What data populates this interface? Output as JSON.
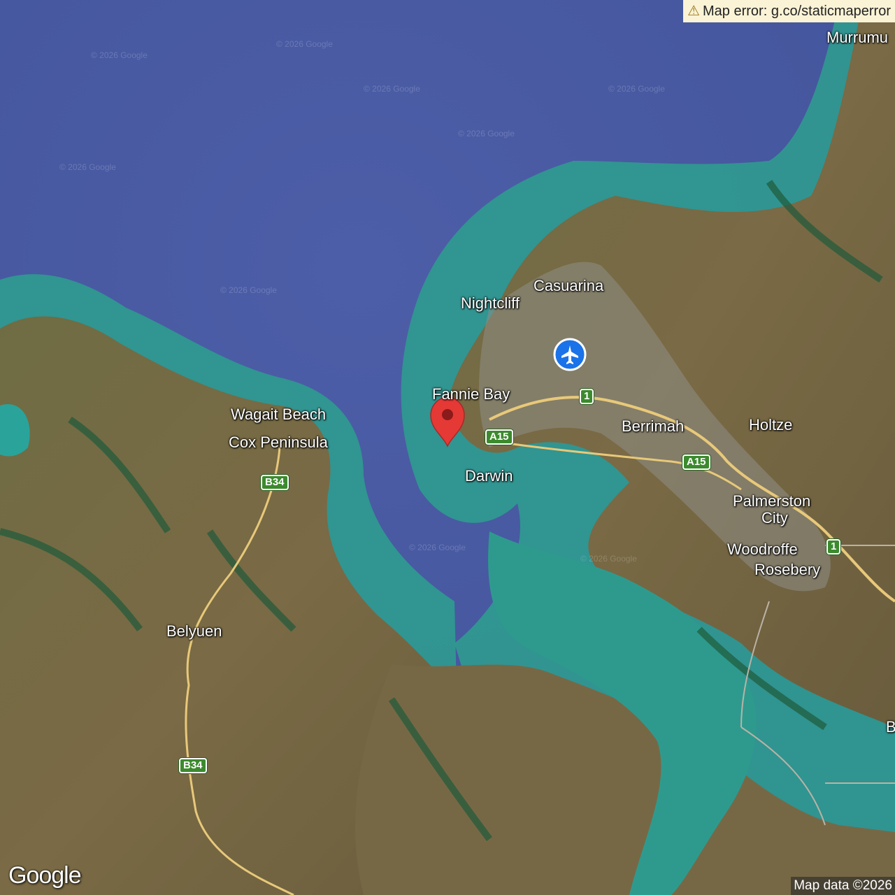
{
  "error_banner": {
    "icon": "warning-icon",
    "text": "Map error: g.co/staticmaperror"
  },
  "places": [
    {
      "key": "murrumujuk",
      "label": "Murrumu"
    },
    {
      "key": "casuarina",
      "label": "Casuarina"
    },
    {
      "key": "nightcliff",
      "label": "Nightcliff"
    },
    {
      "key": "fannie-bay",
      "label": "Fannie Bay"
    },
    {
      "key": "berrimah",
      "label": "Berrimah"
    },
    {
      "key": "holtze",
      "label": "Holtze"
    },
    {
      "key": "wagait-beach",
      "label": "Wagait Beach"
    },
    {
      "key": "cox-peninsula",
      "label": "Cox Peninsula"
    },
    {
      "key": "darwin",
      "label": "Darwin"
    },
    {
      "key": "palmerston",
      "label": "Palmerston"
    },
    {
      "key": "city",
      "label": "City"
    },
    {
      "key": "woodroffe",
      "label": "Woodroffe"
    },
    {
      "key": "rosebery",
      "label": "Rosebery"
    },
    {
      "key": "belyuen",
      "label": "Belyuen"
    },
    {
      "key": "edge-b",
      "label": "B"
    }
  ],
  "shields": [
    {
      "key": "route-1-north",
      "label": "1"
    },
    {
      "key": "a15-west",
      "label": "A15"
    },
    {
      "key": "a15-east",
      "label": "A15"
    },
    {
      "key": "b34-north",
      "label": "B34"
    },
    {
      "key": "route-1-south",
      "label": "1"
    },
    {
      "key": "b34-south",
      "label": "B34"
    }
  ],
  "watermark": "© 2026 Google",
  "logo": "Google",
  "attribution": "Map data ©2026",
  "markers": {
    "pin": "location-pin-icon",
    "airport": "airport-icon"
  },
  "colors": {
    "sea": "#4a5aa0",
    "shallows": "#2f9b8f",
    "land": "#6d6a3e",
    "pin": "#e53935",
    "airport": "#1a73e8",
    "shield": "#3c8a2e"
  }
}
